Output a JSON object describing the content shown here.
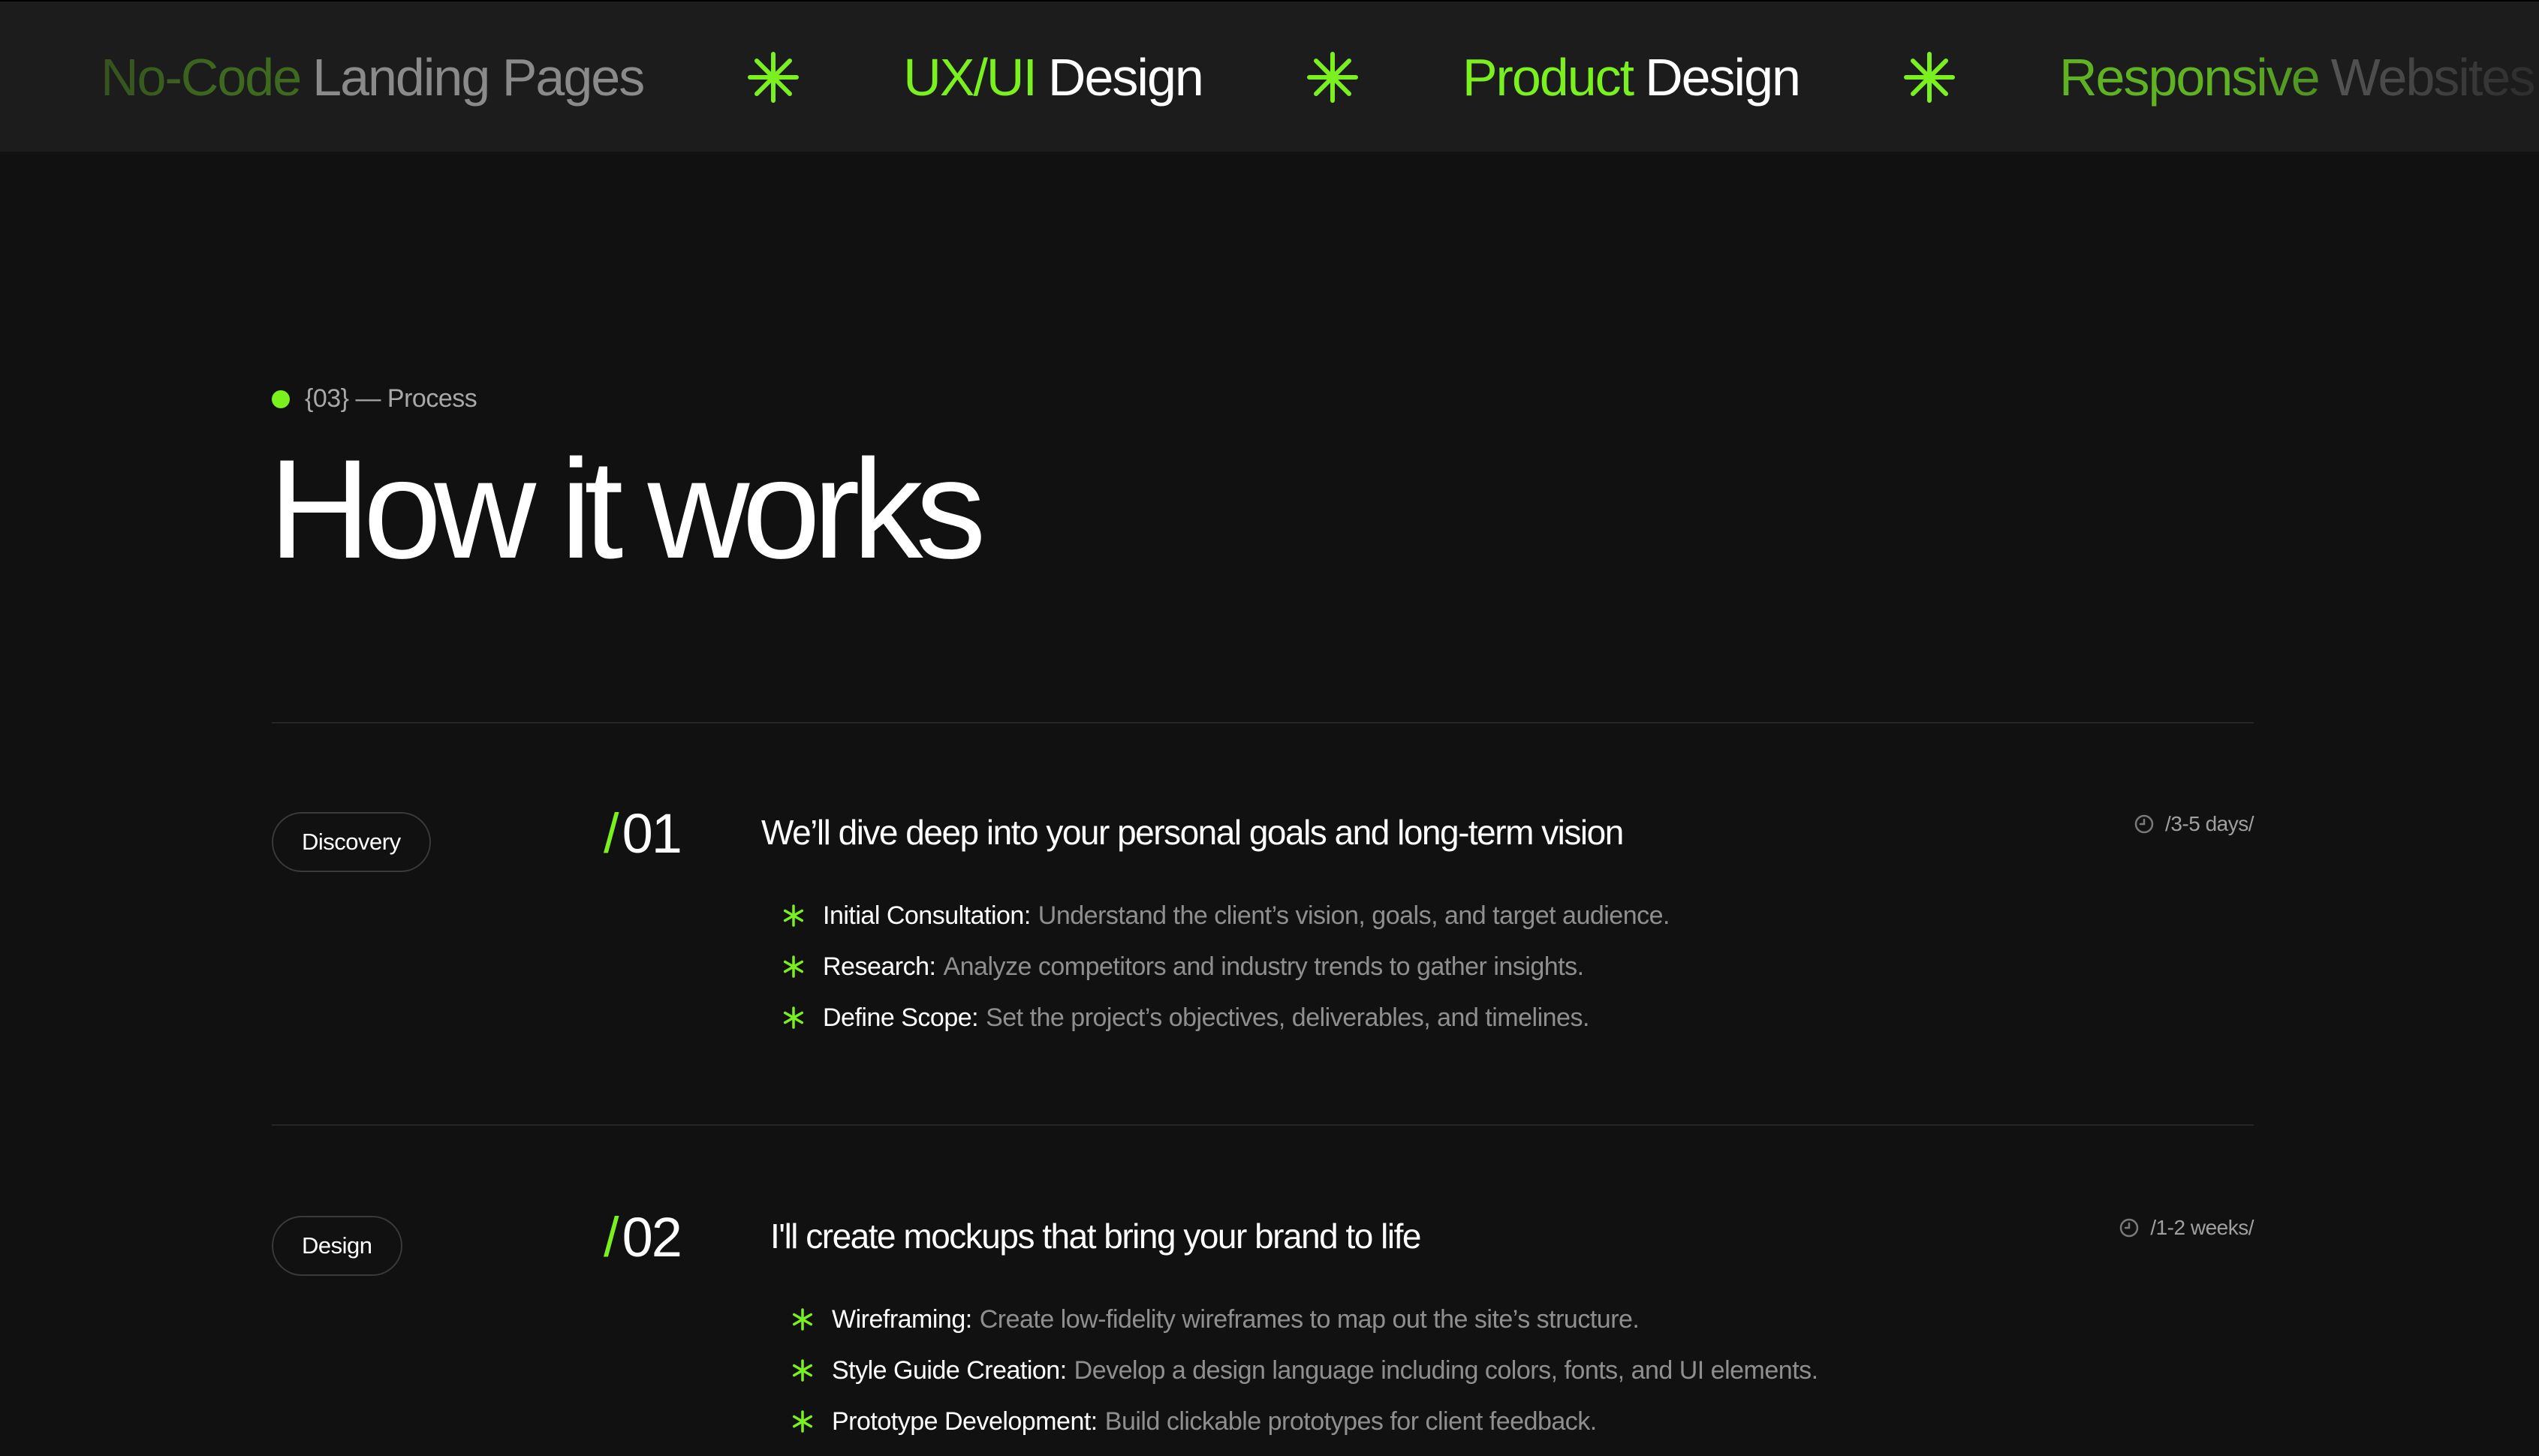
{
  "marquee": {
    "items": [
      {
        "highlight": "No-Code",
        "rest": "Landing Pages"
      },
      {
        "highlight": "UX/UI",
        "rest": "Design"
      },
      {
        "highlight": "Product",
        "rest": "Design"
      },
      {
        "highlight": "Responsive",
        "rest": "Websites"
      }
    ],
    "separator_icon": "asterisk-icon"
  },
  "section": {
    "eyebrow": "{03} — Process",
    "title": "How it works"
  },
  "steps": [
    {
      "tag": "Discovery",
      "number": "01",
      "title": "We’ll dive deep into your personal goals and long-term vision",
      "duration": "/3-5 days/",
      "items": [
        {
          "key": "Initial Consultation:",
          "value": "Understand the client’s vision, goals, and target audience."
        },
        {
          "key": "Research:",
          "value": "Analyze competitors and industry trends to gather insights."
        },
        {
          "key": "Define Scope:",
          "value": "Set the project’s objectives, deliverables, and timelines."
        }
      ]
    },
    {
      "tag": "Design",
      "number": "02",
      "title": "I'll create mockups that bring your brand to life",
      "duration": "/1-2 weeks/",
      "items": [
        {
          "key": "Wireframing:",
          "value": "Create low-fidelity wireframes to map out the site’s structure."
        },
        {
          "key": "Style Guide Creation:",
          "value": "Develop a design language including colors, fonts, and UI elements."
        },
        {
          "key": "Prototype Development:",
          "value": "Build clickable prototypes for client feedback."
        }
      ]
    }
  ],
  "colors": {
    "accent": "#7af01f",
    "background": "#111111",
    "marquee_bg": "#1c1c1c"
  }
}
